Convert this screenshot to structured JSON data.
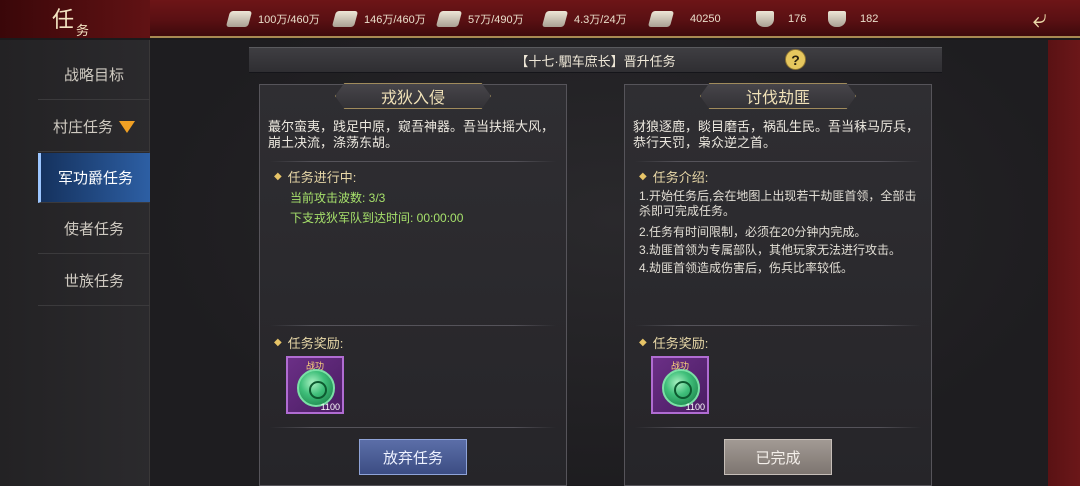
{
  "header": {
    "title_big": "任",
    "title_small": "务",
    "resources": [
      {
        "icon": "wheat-icon",
        "value": "100万/460万"
      },
      {
        "icon": "lumber-icon",
        "value": "146万/460万"
      },
      {
        "icon": "stone-icon",
        "value": "57万/490万"
      },
      {
        "icon": "iron-icon",
        "value": "4.3万/24万"
      },
      {
        "icon": "feather-icon",
        "value": "40250"
      },
      {
        "icon": "gold-icon",
        "value": "176"
      },
      {
        "icon": "silver-icon",
        "value": "182"
      }
    ],
    "back_symbol": "⤶"
  },
  "sidebar": {
    "items": [
      {
        "label": "战略目标"
      },
      {
        "label": "村庄任务"
      },
      {
        "label": "军功爵任务"
      },
      {
        "label": "使者任务"
      },
      {
        "label": "世族任务"
      }
    ],
    "active_index": 2
  },
  "main": {
    "rank_title": "【十七·駟车庶长】晋升任务",
    "help_symbol": "?",
    "left_panel": {
      "title": "戎狄入侵",
      "desc": "蕞尔蛮夷，践足中原，窥吾神器。吾当扶摇大风，崩土决流，涤荡东胡。",
      "section_title": "任务进行中:",
      "progress_line1": "当前攻击波数:  3/3",
      "progress_line2": "下支戎狄军队到达时间: 00:00:00",
      "reward_title": "任务奖励:",
      "reward_label": "战功",
      "reward_qty": "1100",
      "button_label": "放弃任务"
    },
    "right_panel": {
      "title": "讨伐劫匪",
      "desc": "豺狼逐鹿，睒目磨舌，祸乱生民。吾当秣马厉兵，恭行天罚，枭众逆之首。",
      "section_title": "任务介绍:",
      "info_lines": [
        "1.开始任务后,会在地图上出现若干劫匪首领，全部击杀即可完成任务。",
        "2.任务有时间限制，必须在20分钟内完成。",
        "3.劫匪首领为专属部队，其他玩家无法进行攻击。",
        "4.劫匪首领造成伤害后，伤兵比率较低。"
      ],
      "reward_title": "任务奖励:",
      "reward_label": "战功",
      "reward_qty": "1100",
      "button_label": "已完成"
    }
  },
  "colors": {
    "topbar": "#5a1013",
    "active_tab": "#2d5fa4",
    "progress_text": "#a6e06b",
    "section_title": "#e7d7a7",
    "reward_frame": "#b06cd2"
  }
}
